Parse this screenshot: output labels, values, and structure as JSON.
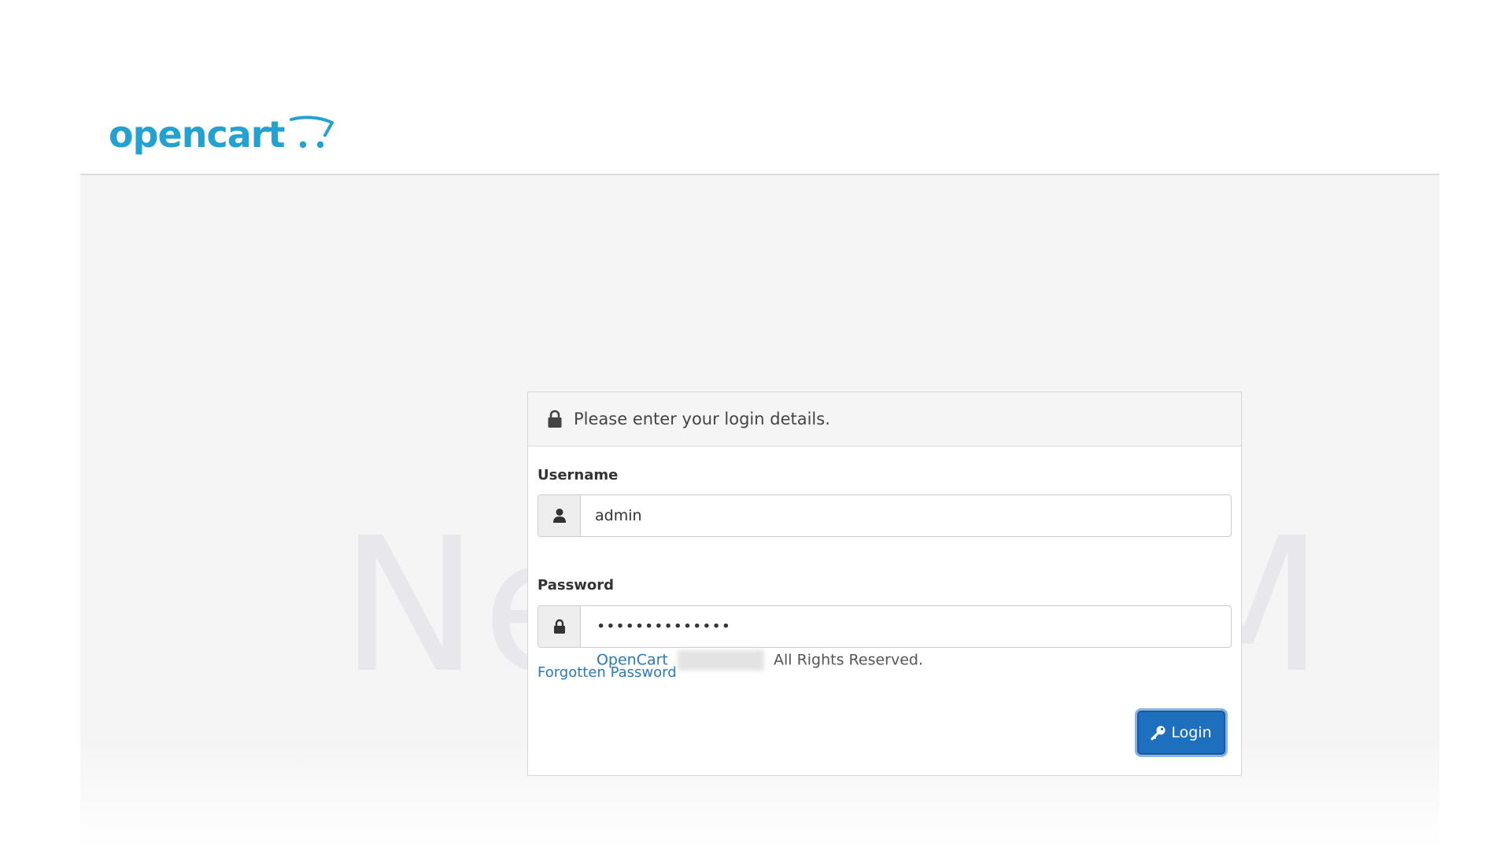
{
  "brand": {
    "name": "opencart",
    "color": "#23a1d1"
  },
  "watermark": "NeuronVM",
  "login_panel": {
    "heading": "Please enter your login details.",
    "heading_icon": "lock-icon",
    "username": {
      "label": "Username",
      "value": "admin",
      "icon": "user-icon"
    },
    "password": {
      "label": "Password",
      "masked_value": "••••••••••••••",
      "icon": "lock-icon"
    },
    "forgot_link": "Forgotten Password",
    "login_button": {
      "label": "Login",
      "icon": "key-icon",
      "color": "#1e6fbe"
    }
  },
  "footer": {
    "link": "OpenCart",
    "text": "All Rights Reserved."
  }
}
